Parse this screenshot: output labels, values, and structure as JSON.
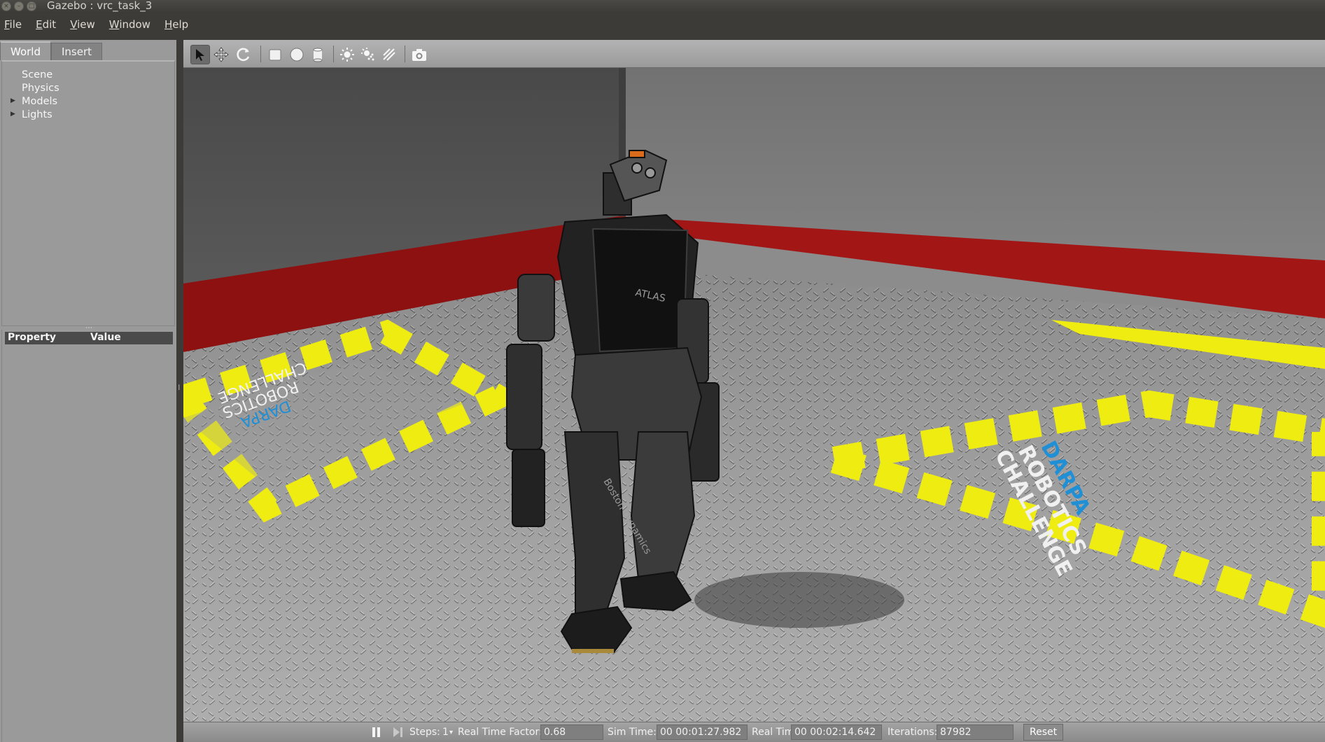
{
  "window": {
    "title": "Gazebo : vrc_task_3"
  },
  "menubar": {
    "items": [
      {
        "label": "File",
        "accel": "F",
        "rest": "ile"
      },
      {
        "label": "Edit",
        "accel": "E",
        "rest": "dit"
      },
      {
        "label": "View",
        "accel": "V",
        "rest": "iew"
      },
      {
        "label": "Window",
        "accel": "W",
        "rest": "indow"
      },
      {
        "label": "Help",
        "accel": "H",
        "rest": "elp"
      }
    ]
  },
  "left_panel": {
    "tabs": [
      {
        "label": "World"
      },
      {
        "label": "Insert"
      }
    ],
    "active_tab": "World",
    "tree": [
      {
        "label": "Scene",
        "expandable": false
      },
      {
        "label": "Physics",
        "expandable": false
      },
      {
        "label": "Models",
        "expandable": true
      },
      {
        "label": "Lights",
        "expandable": true
      }
    ],
    "property_table": {
      "col1": "Property",
      "col2": "Value"
    }
  },
  "toolbar": {
    "icons": [
      "select-arrow-icon",
      "translate-icon",
      "rotate-icon",
      "box-icon",
      "sphere-icon",
      "cylinder-icon",
      "point-light-icon",
      "spot-light-icon",
      "directional-light-icon",
      "screenshot-camera-icon"
    ],
    "selected": "select-arrow-icon"
  },
  "scene": {
    "floor_logo_left": {
      "line1": "DARPA",
      "line2": "ROBOTICS",
      "line3": "CHALLENGE"
    },
    "floor_logo_right": {
      "line1": "DARPA",
      "line2": "ROBOTICS",
      "line3": "CHALLENGE"
    },
    "robot_chest_label": "ATLAS",
    "robot_leg_label": "Boston Dynamics",
    "colors": {
      "wall": "#5e5e5e",
      "wall_stripe": "#9b1010",
      "floor": "#9d9d9d",
      "hazard_yellow": "#f2ee10",
      "logo_blue": "#1f8fd6"
    }
  },
  "statusbar": {
    "steps_label": "Steps:",
    "steps_value": "1",
    "real_time_factor_label": "Real Time Factor:",
    "real_time_factor": "0.68",
    "sim_time_label": "Sim Time:",
    "sim_time": "00 00:01:27.982",
    "real_time_label": "Real Time:",
    "real_time": "00 00:02:14.642",
    "iterations_label": "Iterations:",
    "iterations": "87982",
    "reset_label": "Reset"
  }
}
